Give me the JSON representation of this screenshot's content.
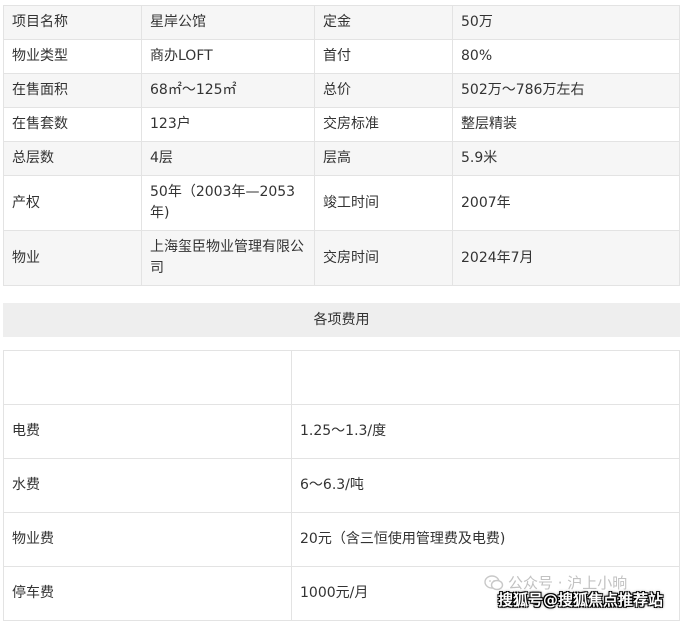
{
  "info_table": {
    "rows": [
      [
        "项目名称",
        "星岸公馆",
        "定金",
        "50万"
      ],
      [
        "物业类型",
        "商办LOFT",
        "首付",
        "80%"
      ],
      [
        "在售面积",
        "68㎡～125㎡",
        "总价",
        "502万～786万左右"
      ],
      [
        "在售套数",
        "123户",
        "交房标准",
        "整层精装"
      ],
      [
        "总层数",
        "4层",
        "层高",
        "5.9米"
      ],
      [
        "产权",
        "50年（2003年—2053年)",
        "竣工时间",
        "2007年"
      ],
      [
        "物业",
        "上海玺臣物业管理有限公司",
        "交房时间",
        "2024年7月"
      ]
    ]
  },
  "fees_section": {
    "title": "各项费用",
    "header_row": [
      "",
      ""
    ],
    "rows": [
      [
        "电费",
        "1.25～1.3/度"
      ],
      [
        "水费",
        "6～6.3/吨"
      ],
      [
        "物业费",
        "20元（含三恒使用管理费及电费)"
      ],
      [
        "停车费",
        "1000元/月"
      ]
    ]
  },
  "watermark": {
    "account": "公众号 · 沪上小晌",
    "source": "搜狐号@搜狐焦点推荐站"
  }
}
